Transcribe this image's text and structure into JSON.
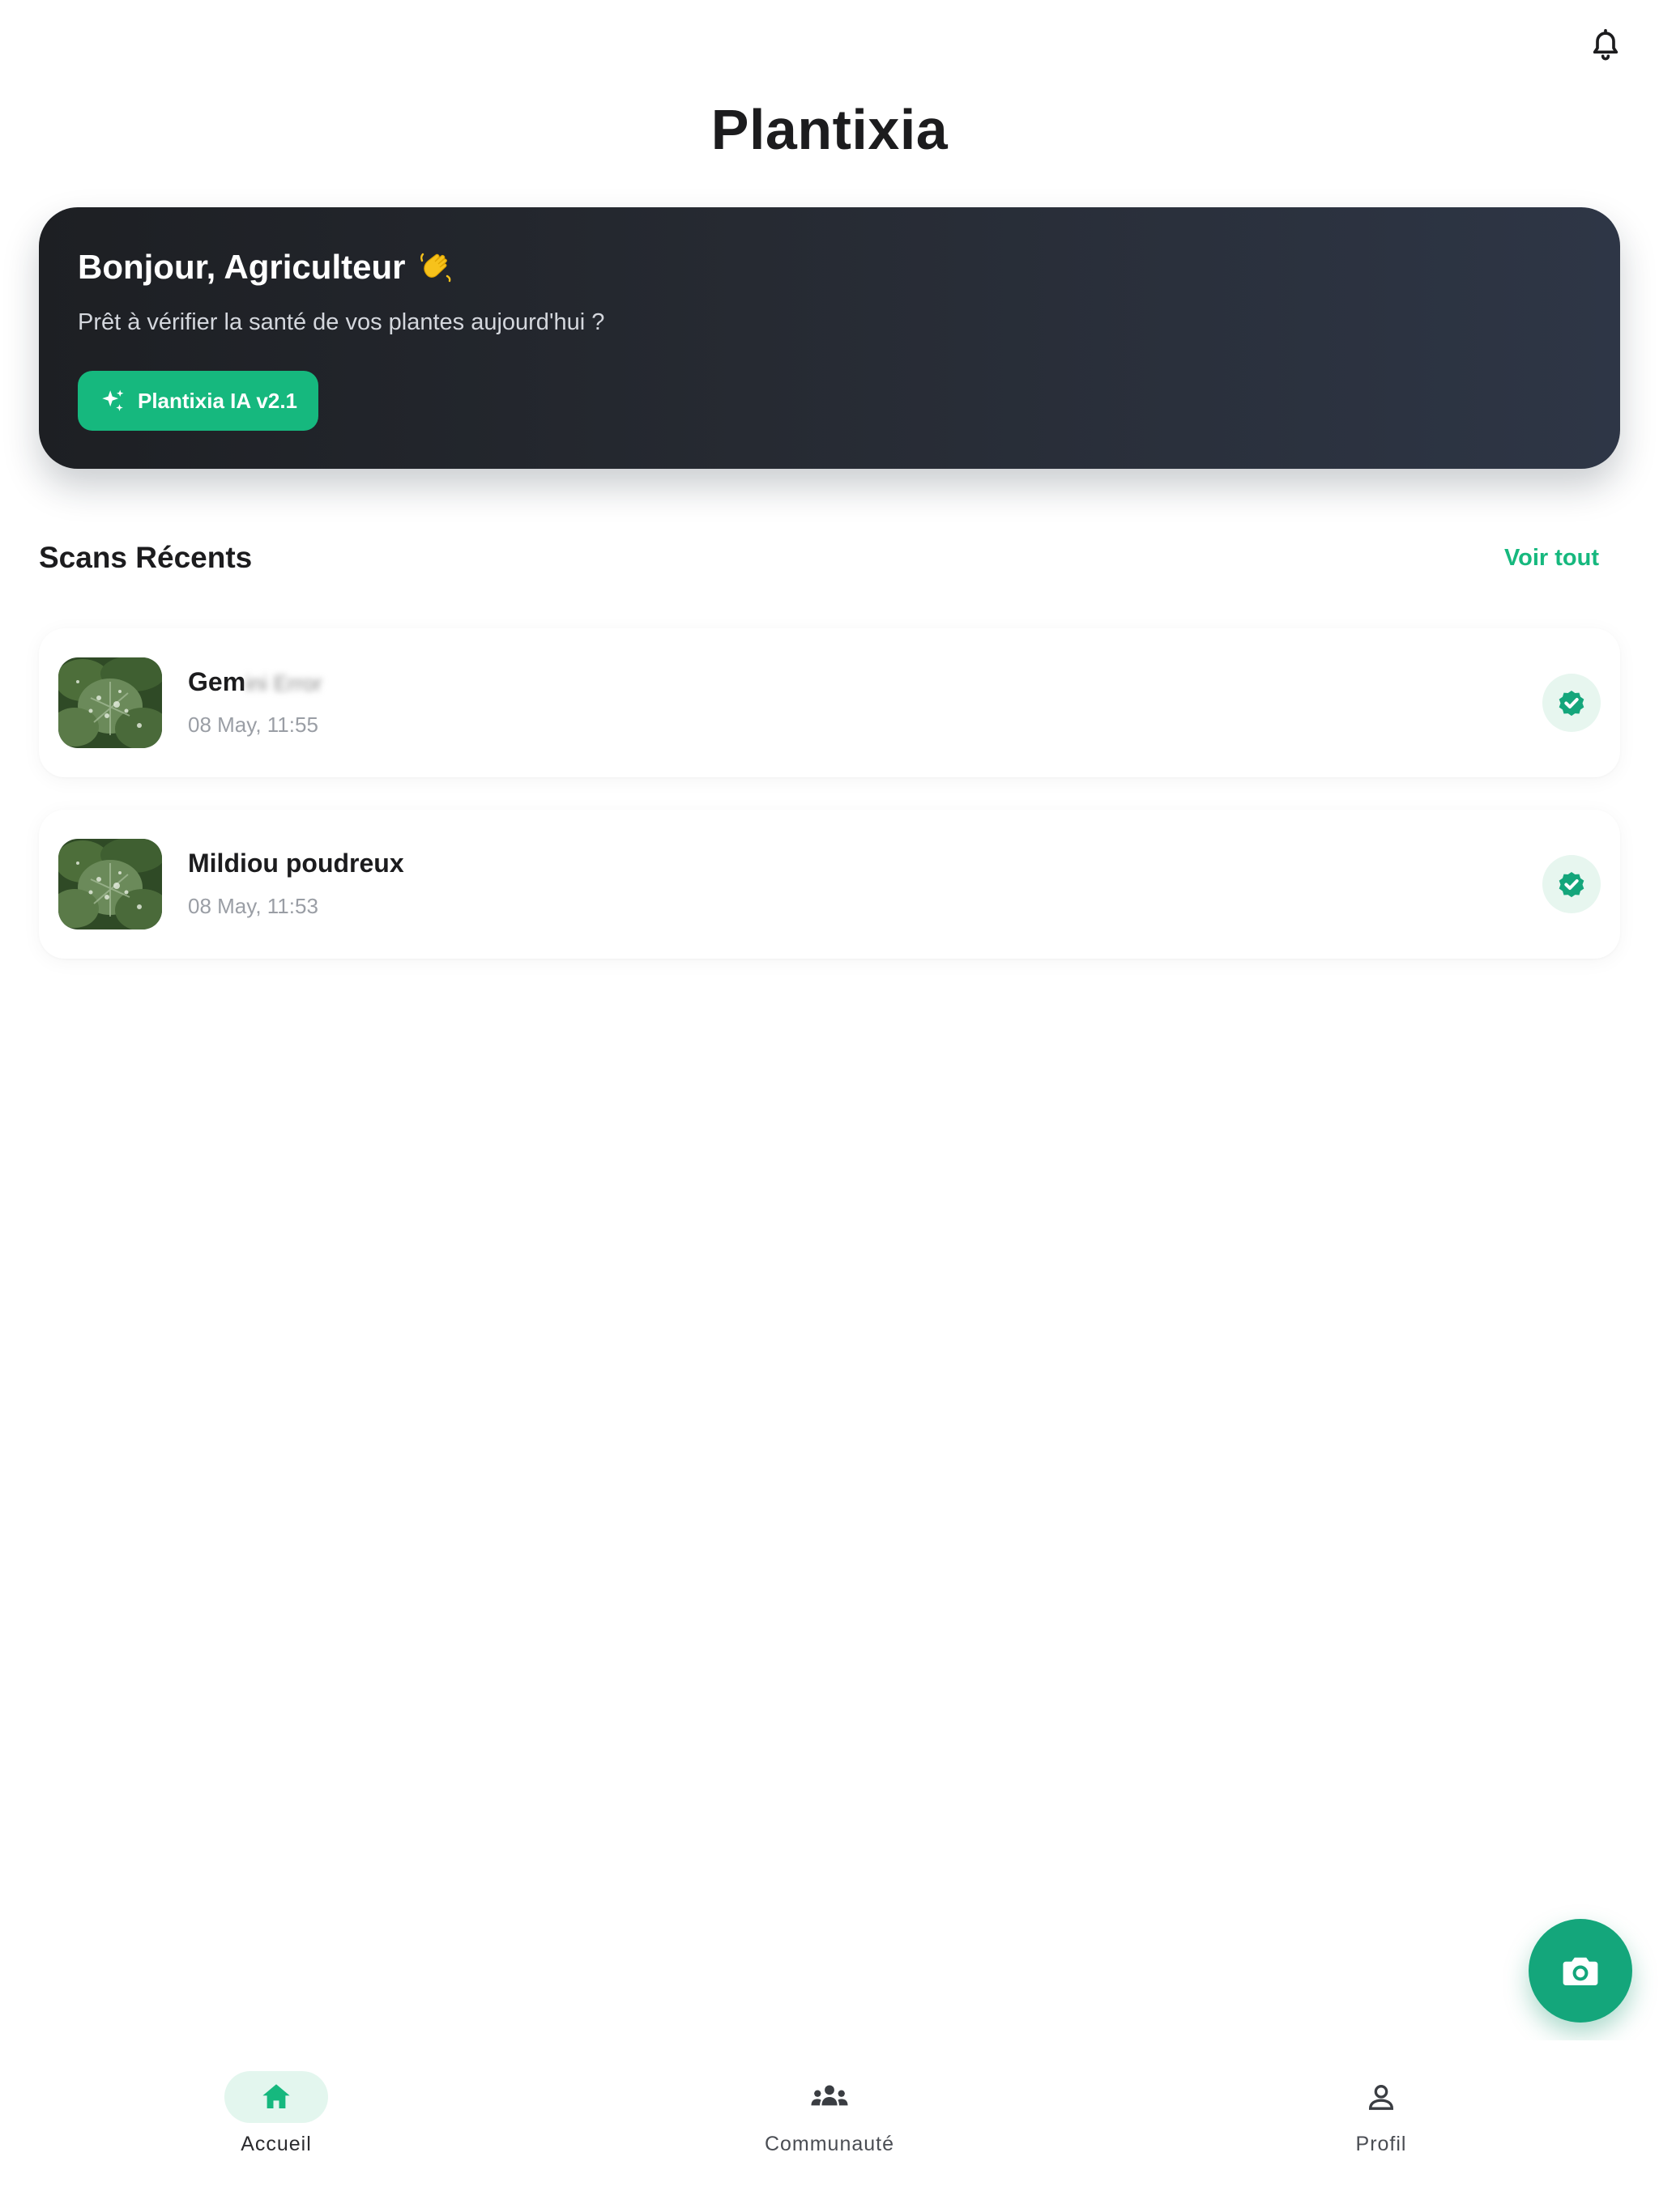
{
  "header": {
    "app_title": "Plantixia",
    "bell_icon": "bell-icon"
  },
  "hero": {
    "greeting": "Bonjour, Agriculteur",
    "greeting_icon": "waving-hand-icon",
    "subtitle": "Prêt à vérifier la santé de vos plantes aujourd'hui ?",
    "badge_label": "Plantixia IA v2.1",
    "badge_icon": "sparkles-icon",
    "gradient": [
      "#1d1f23",
      "#2e3646"
    ]
  },
  "recent_scans": {
    "title": "Scans Récents",
    "see_all_label": "Voir tout",
    "items": [
      {
        "name": "Gem",
        "name_obscured": "ini Error",
        "date": "08 May, 11:55",
        "status_icon": "verified-check-icon"
      },
      {
        "name": "Mildiou poudreux",
        "date": "08 May, 11:53",
        "status_icon": "verified-check-icon"
      }
    ]
  },
  "fab": {
    "icon": "camera-icon"
  },
  "bottom_nav": {
    "items": [
      {
        "label": "Accueil",
        "icon": "home-icon",
        "active": true
      },
      {
        "label": "Communauté",
        "icon": "community-icon",
        "active": false
      },
      {
        "label": "Profil",
        "icon": "profile-icon",
        "active": false
      }
    ]
  },
  "colors": {
    "accent": "#16b87e",
    "fab": "#14a67b",
    "text": "#1c1c1e",
    "muted": "#9a9ea5"
  }
}
